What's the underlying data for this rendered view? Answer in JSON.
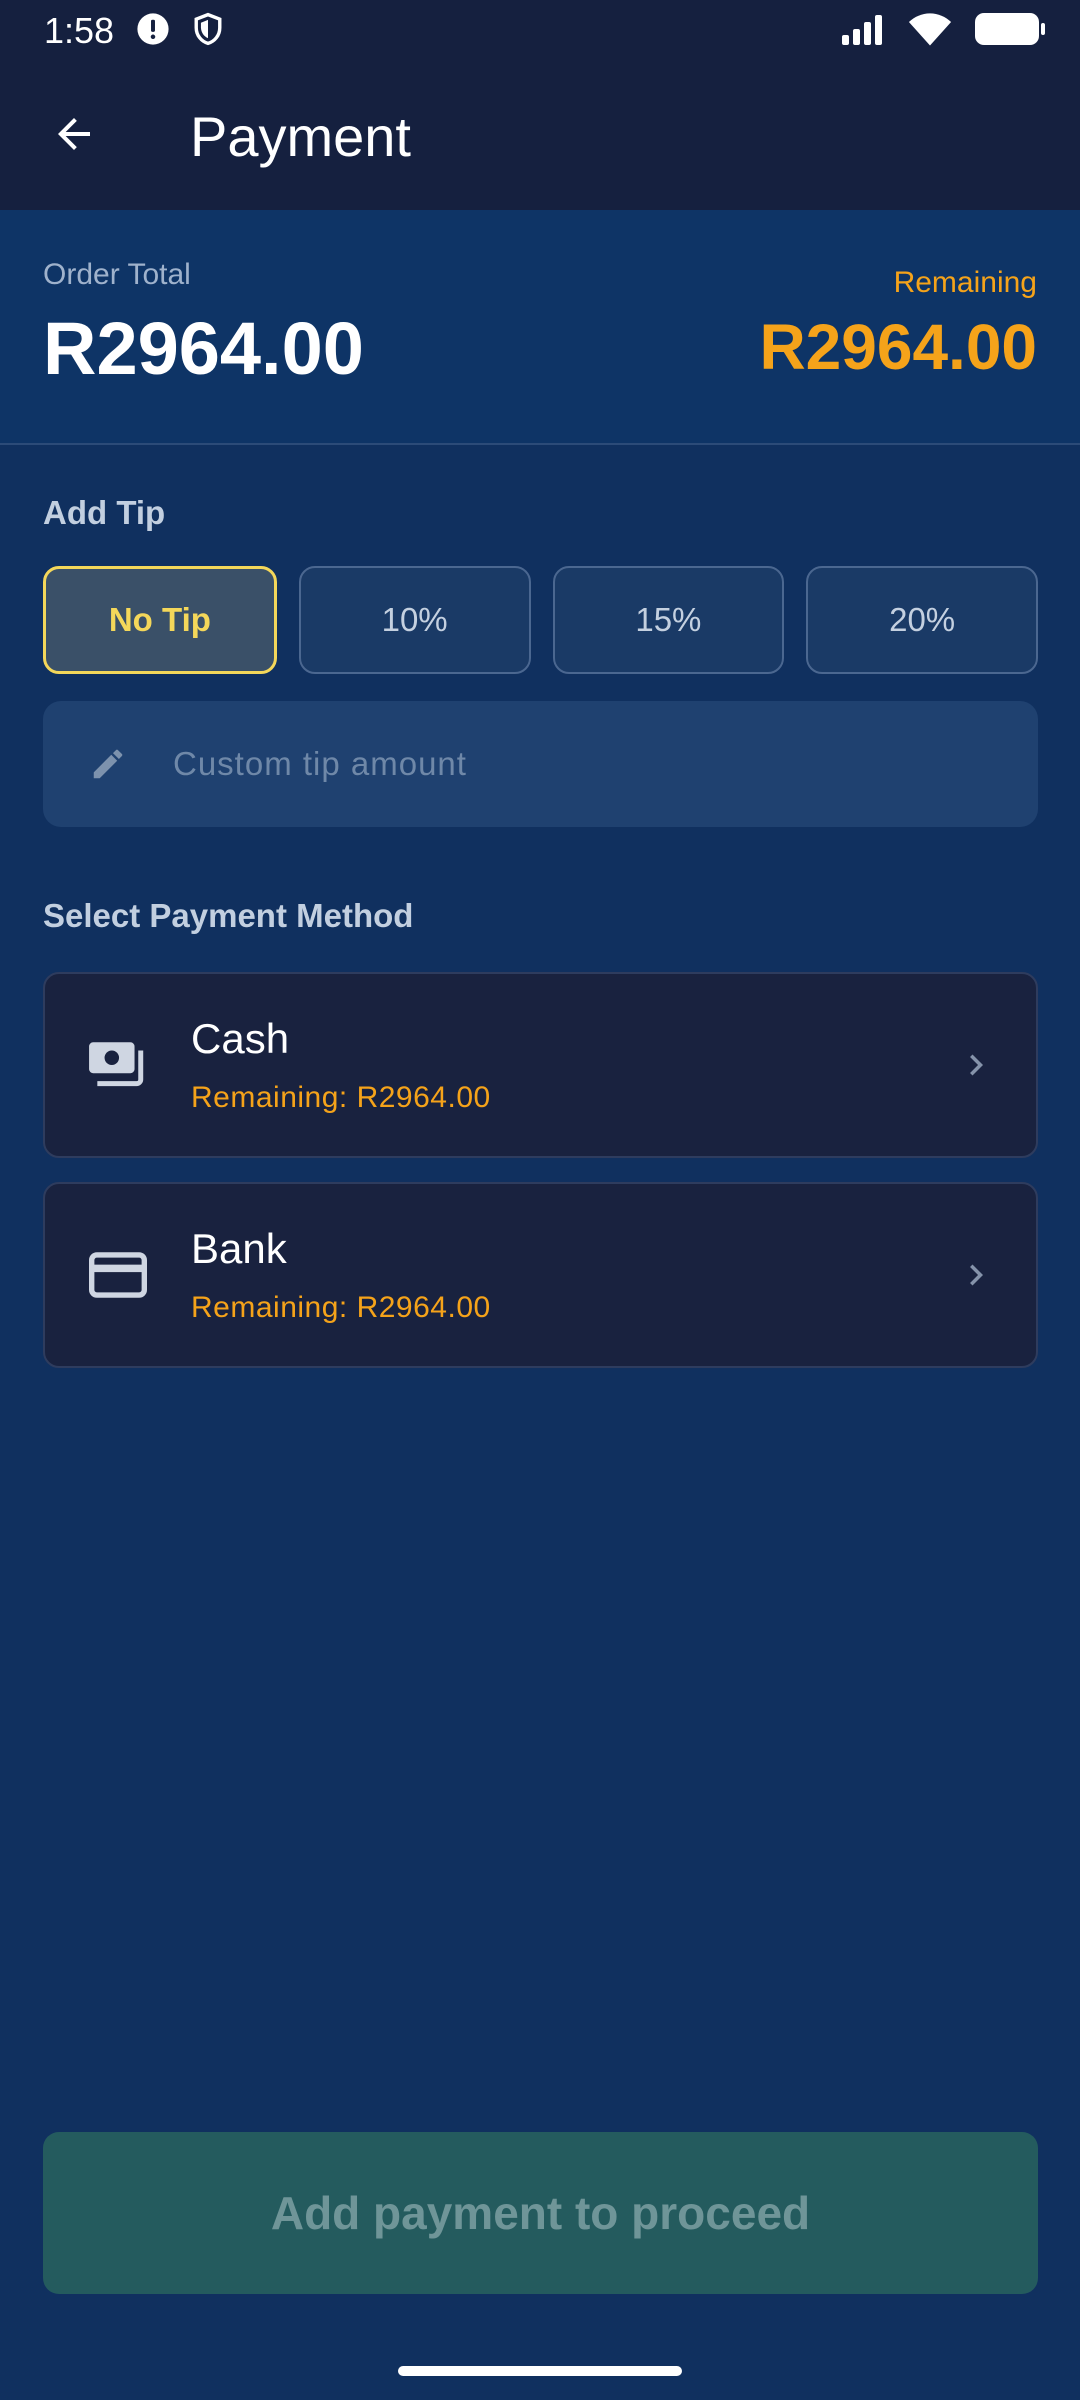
{
  "status_bar": {
    "time": "1:58",
    "icons": [
      "alert-icon",
      "shield-icon",
      "signal-icon",
      "wifi-icon",
      "battery-icon"
    ]
  },
  "app_bar": {
    "back_icon": "arrow-back-icon",
    "title": "Payment"
  },
  "summary": {
    "order_total_label": "Order Total",
    "order_total_value": "R2964.00",
    "remaining_label": "Remaining",
    "remaining_value": "R2964.00"
  },
  "tip": {
    "section_title": "Add Tip",
    "options": [
      "No Tip",
      "10%",
      "15%",
      "20%"
    ],
    "selected": "No Tip",
    "custom_placeholder": "Custom tip amount",
    "custom_value": ""
  },
  "payment_methods": {
    "section_title": "Select Payment Method",
    "items": [
      {
        "name": "Cash",
        "remaining": "Remaining: R2964.00",
        "icon": "cash-icon"
      },
      {
        "name": "Bank",
        "remaining": "Remaining: R2964.00",
        "icon": "credit-card-icon"
      }
    ]
  },
  "proceed_button": {
    "label": "Add payment to proceed"
  },
  "colors": {
    "background": "#10305f",
    "app_bar": "#15203f",
    "accent_orange": "#f5a31a",
    "selected_tip": "#f4d75a",
    "proceed_disabled": "#245b5e"
  }
}
